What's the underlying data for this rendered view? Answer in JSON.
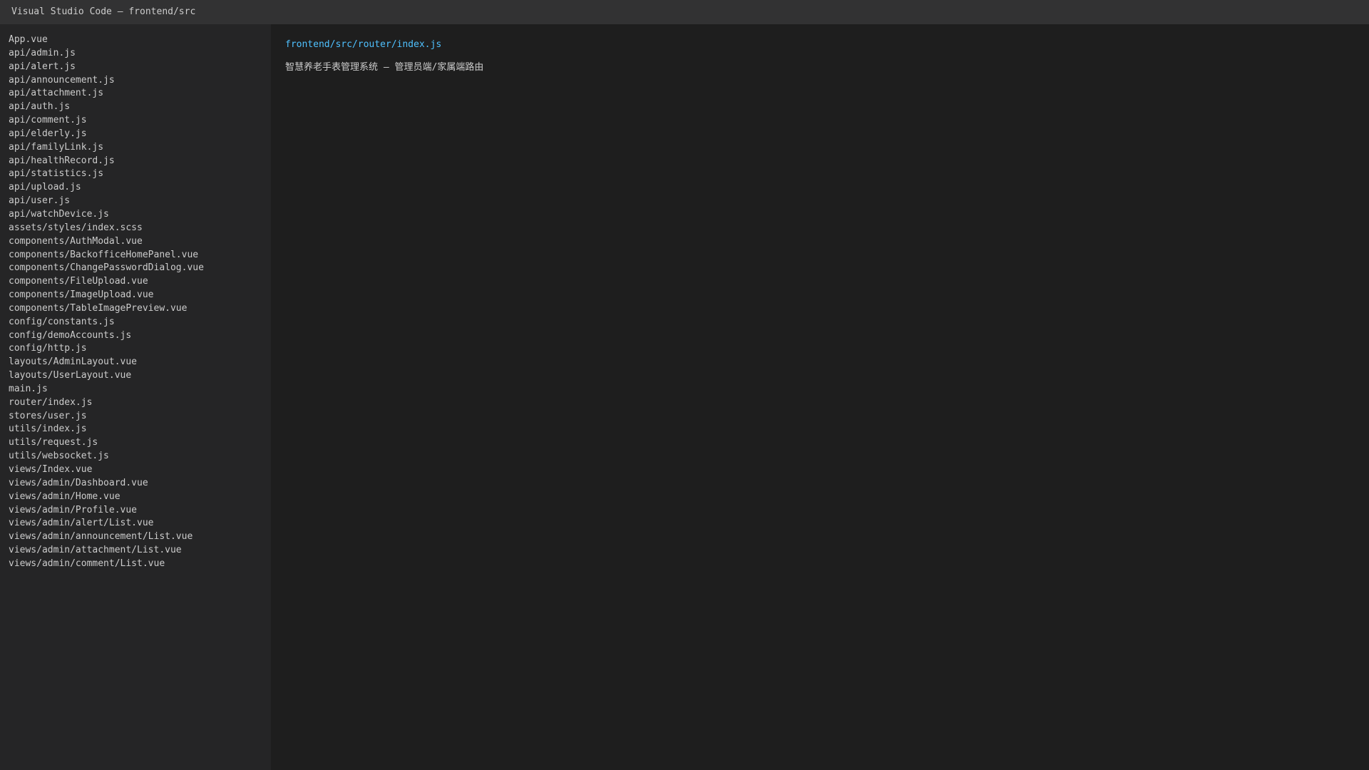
{
  "window": {
    "title": "Visual Studio Code — frontend/src"
  },
  "sidebar": {
    "files": [
      "App.vue",
      "api/admin.js",
      "api/alert.js",
      "api/announcement.js",
      "api/attachment.js",
      "api/auth.js",
      "api/comment.js",
      "api/elderly.js",
      "api/familyLink.js",
      "api/healthRecord.js",
      "api/statistics.js",
      "api/upload.js",
      "api/user.js",
      "api/watchDevice.js",
      "assets/styles/index.scss",
      "components/AuthModal.vue",
      "components/BackofficeHomePanel.vue",
      "components/ChangePasswordDialog.vue",
      "components/FileUpload.vue",
      "components/ImageUpload.vue",
      "components/TableImagePreview.vue",
      "config/constants.js",
      "config/demoAccounts.js",
      "config/http.js",
      "layouts/AdminLayout.vue",
      "layouts/UserLayout.vue",
      "main.js",
      "router/index.js",
      "stores/user.js",
      "utils/index.js",
      "utils/request.js",
      "utils/websocket.js",
      "views/Index.vue",
      "views/admin/Dashboard.vue",
      "views/admin/Home.vue",
      "views/admin/Profile.vue",
      "views/admin/alert/List.vue",
      "views/admin/announcement/List.vue",
      "views/admin/attachment/List.vue",
      "views/admin/comment/List.vue"
    ]
  },
  "editor": {
    "file_path": "frontend/src/router/index.js",
    "description": "智慧养老手表管理系统 — 管理员端/家属端路由"
  },
  "colors": {
    "titlebar_bg": "#323233",
    "sidebar_bg": "#252526",
    "editor_bg": "#1e1e1e",
    "text": "#cccccc",
    "path_accent": "#4fc1ff"
  }
}
